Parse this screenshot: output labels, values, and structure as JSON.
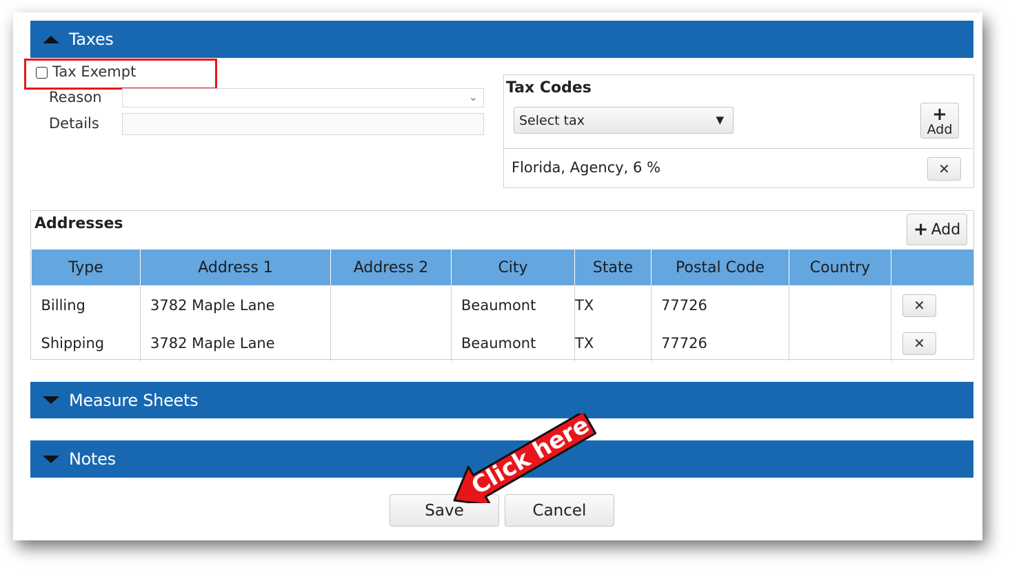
{
  "taxes": {
    "title": "Taxes"
  },
  "tax_exempt": {
    "label": "Tax Exempt",
    "checked": false
  },
  "reason": {
    "label": "Reason",
    "value": ""
  },
  "details": {
    "label": "Details",
    "value": ""
  },
  "tax_codes": {
    "title": "Tax Codes",
    "select_placeholder": "Select tax",
    "add_label": "Add",
    "items": [
      {
        "label": "Florida, Agency, 6 %"
      }
    ]
  },
  "addresses": {
    "title": "Addresses",
    "add_label": "Add",
    "columns": [
      "Type",
      "Address 1",
      "Address 2",
      "City",
      "State",
      "Postal Code",
      "Country",
      ""
    ],
    "rows": [
      {
        "type": "Billing",
        "address1": "3782 Maple Lane",
        "address2": "",
        "city": "Beaumont",
        "state": "TX",
        "postal": "77726",
        "country": ""
      },
      {
        "type": "Shipping",
        "address1": "3782 Maple Lane",
        "address2": "",
        "city": "Beaumont",
        "state": "TX",
        "postal": "77726",
        "country": ""
      }
    ]
  },
  "measure_sheets": {
    "title": "Measure Sheets"
  },
  "notes": {
    "title": "Notes"
  },
  "actions": {
    "save": "Save",
    "cancel": "Cancel"
  },
  "callout": {
    "text": "Click here",
    "color": "#e8161b"
  }
}
